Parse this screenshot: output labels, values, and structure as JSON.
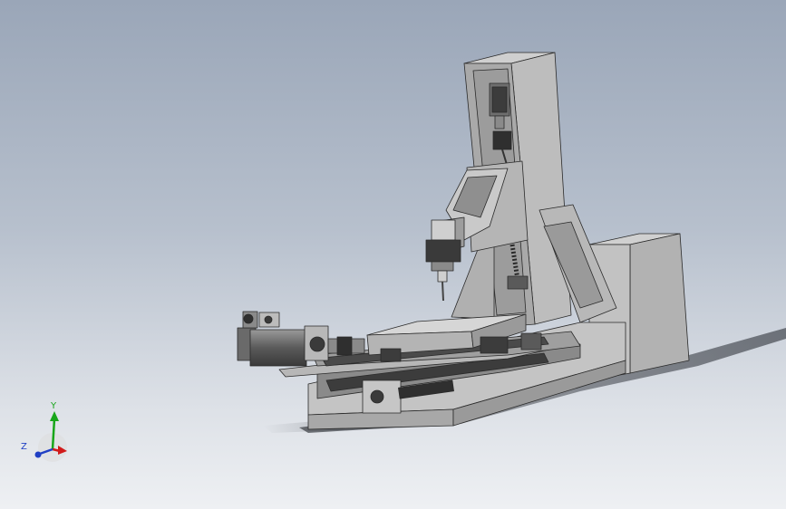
{
  "viewport": {
    "background_top": "#9aa6b8",
    "background_bottom": "#eef0f3",
    "model_color": "#a9a9a9",
    "model_edge_color": "#2a2a2a"
  },
  "triad": {
    "x_color": "#d11a1a",
    "y_color": "#18a61a",
    "z_color": "#1f3fc4",
    "y_label": "Y",
    "z_label": "Z"
  }
}
